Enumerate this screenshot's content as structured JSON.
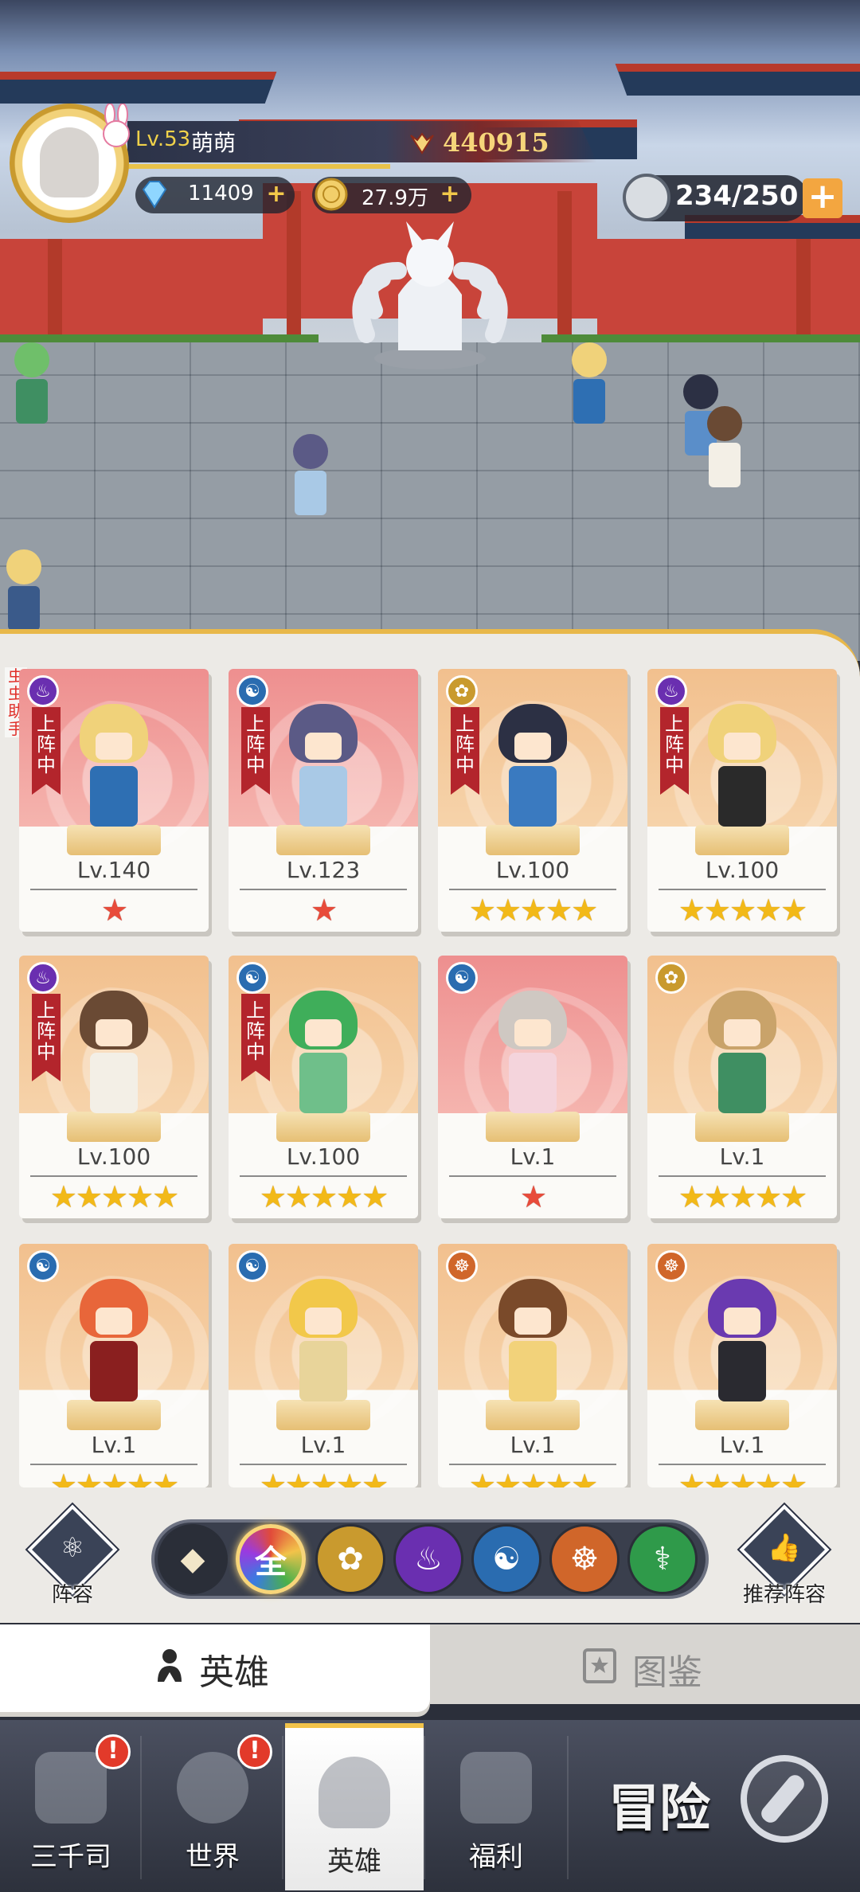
{
  "player": {
    "level": "Lv.53",
    "name": "萌萌",
    "power": "440915",
    "diamonds": "11409",
    "gold": "27.9万",
    "stamina": "234/250"
  },
  "helper_tag": "虫虫助手",
  "ribbon_text": "上阵中",
  "heroes": [
    {
      "level": "Lv.140",
      "stars": "★",
      "star_color": "red",
      "element": "fire",
      "deployed": true,
      "bg": "red"
    },
    {
      "level": "Lv.123",
      "stars": "★",
      "star_color": "red",
      "element": "water",
      "deployed": true,
      "bg": "red"
    },
    {
      "level": "Lv.100",
      "stars": "★★★★★",
      "star_color": "gold",
      "element": "holy",
      "deployed": true,
      "bg": "gold"
    },
    {
      "level": "Lv.100",
      "stars": "★★★★★",
      "star_color": "gold",
      "element": "fire",
      "deployed": true,
      "bg": "gold"
    },
    {
      "level": "Lv.100",
      "stars": "★★★★★",
      "star_color": "gold",
      "element": "fire",
      "deployed": true,
      "bg": "gold"
    },
    {
      "level": "Lv.100",
      "stars": "★★★★★",
      "star_color": "gold",
      "element": "water",
      "deployed": true,
      "bg": "gold"
    },
    {
      "level": "Lv.1",
      "stars": "★",
      "star_color": "red",
      "element": "water",
      "deployed": false,
      "bg": "red"
    },
    {
      "level": "Lv.1",
      "stars": "★★★★★",
      "star_color": "gold",
      "element": "holy",
      "deployed": false,
      "bg": "gold"
    },
    {
      "level": "Lv.1",
      "stars": "★★★★★",
      "star_color": "gold",
      "element": "water",
      "deployed": false,
      "bg": "gold"
    },
    {
      "level": "Lv.1",
      "stars": "★★★★★",
      "star_color": "gold",
      "element": "water",
      "deployed": false,
      "bg": "gold"
    },
    {
      "level": "Lv.1",
      "stars": "★★★★★",
      "star_color": "gold",
      "element": "zen",
      "deployed": false,
      "bg": "gold"
    },
    {
      "level": "Lv.1",
      "stars": "★★★★★",
      "star_color": "gold",
      "element": "zen",
      "deployed": false,
      "bg": "gold"
    }
  ],
  "filters": {
    "lineup_label": "阵容",
    "recommend_label": "推荐阵容",
    "all_label": "全"
  },
  "tabs": {
    "heroes": "英雄",
    "codex": "图鉴"
  },
  "nav": {
    "sanqiansi": "三千司",
    "world": "世界",
    "heroes": "英雄",
    "welfare": "福利",
    "adventure": "冒险",
    "badge": "!"
  },
  "colors": {
    "fire": "#6a2fb0",
    "water": "#2a6cb0",
    "holy": "#c99a2e",
    "zen": "#d0662a",
    "nature": "#2f9a4a",
    "ribbon": "#b3252c"
  }
}
